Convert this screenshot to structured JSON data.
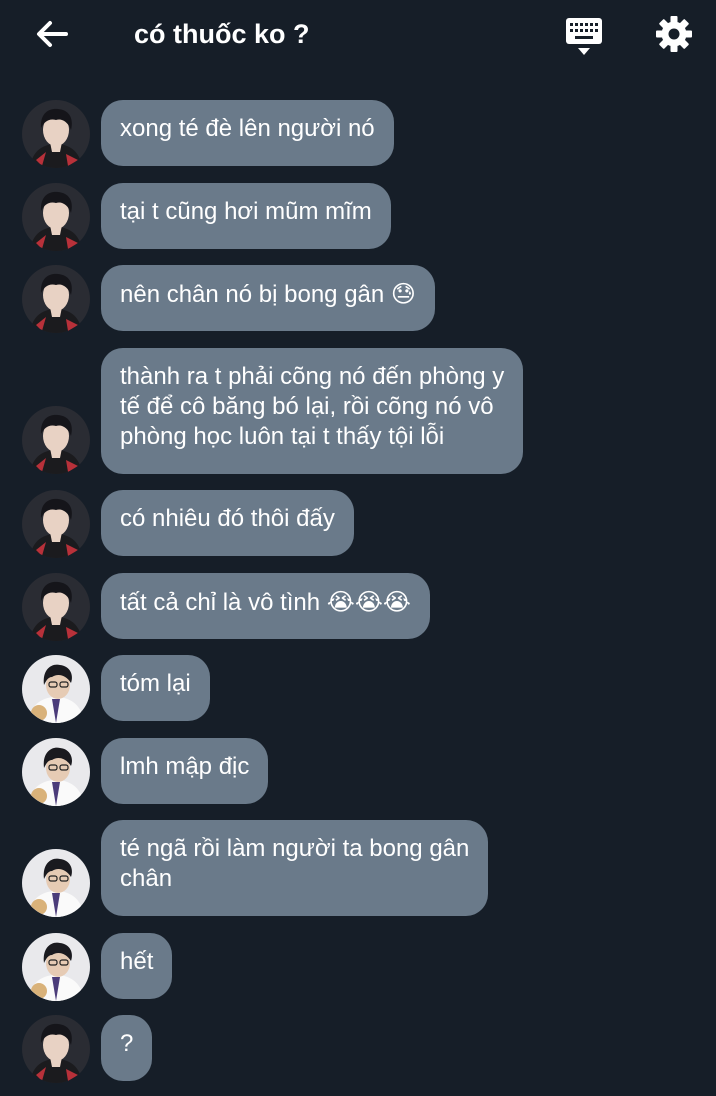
{
  "header": {
    "title": "có thuốc ko ?",
    "back_icon": "arrow-left-icon",
    "keyboard_icon": "keyboard-icon",
    "settings_icon": "gear-icon"
  },
  "colors": {
    "background": "#161e28",
    "bubble": "#6a7a8a",
    "text": "#ffffff"
  },
  "messages": [
    {
      "sender": "A",
      "text": "xong té đè lên người nó",
      "emoji": ""
    },
    {
      "sender": "A",
      "text": "tại t cũng hơi mũm mĩm",
      "emoji": ""
    },
    {
      "sender": "A",
      "text": "nên chân nó bị bong gân",
      "emoji": "😓"
    },
    {
      "sender": "A",
      "text": "thành ra t phải cõng nó đến phòng y\ntế để cô băng bó lại, rồi cõng nó vô\nphòng học luôn tại t thấy tội lỗi",
      "emoji": ""
    },
    {
      "sender": "A",
      "text": "có nhiêu đó thôi đấy",
      "emoji": ""
    },
    {
      "sender": "A",
      "text": "tất cả chỉ là vô tình",
      "emoji": "😭😭😭"
    },
    {
      "sender": "B",
      "text": "tóm lại",
      "emoji": ""
    },
    {
      "sender": "B",
      "text": "lmh mập địc",
      "emoji": ""
    },
    {
      "sender": "B",
      "text": "té ngã rồi làm người ta bong gân\nchân",
      "emoji": ""
    },
    {
      "sender": "B",
      "text": "hết",
      "emoji": ""
    },
    {
      "sender": "A",
      "text": "?",
      "emoji": ""
    }
  ]
}
